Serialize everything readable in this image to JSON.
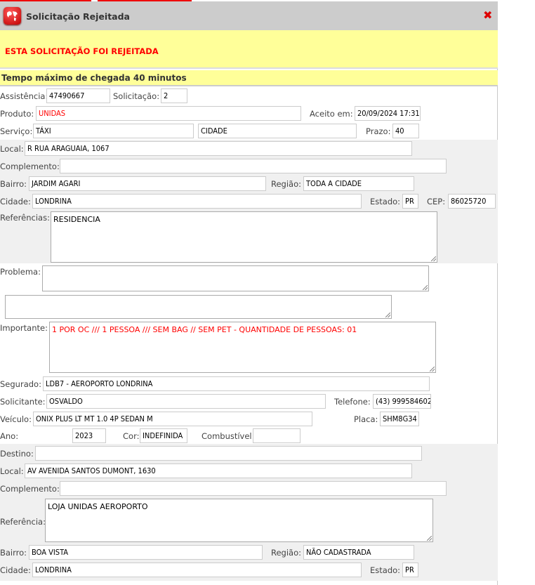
{
  "window": {
    "title": "Solicitação Rejeitada",
    "close_icon": "close-x-icon",
    "logo_icon": "world-map-icon"
  },
  "alert": {
    "message": "ESTA SOLICITAÇÃO FOI REJEITADA",
    "color": "#ff0000",
    "background": "#ffff99"
  },
  "eta": "Tempo máximo de chegada 40 minutos",
  "service": {
    "assistencia_label": "Assistência:",
    "assistencia": "47490667",
    "solicitacao_label": "Solicitação:",
    "solicitacao": "2",
    "produto_label": "Produto:",
    "produto": "UNIDAS",
    "aceito_label": "Aceito em:",
    "aceito": "20/09/2024 17:31",
    "servico_label": "Serviço:",
    "servico": "TÁXI",
    "servico_tipo": "CIDADE",
    "prazo_label": "Prazo:",
    "prazo": "40"
  },
  "origin": {
    "local_label": "Local:",
    "local": "R RUA ARAGUAIA, 1067",
    "complemento_label": "Complemento:",
    "complemento": "",
    "bairro_label": "Bairro:",
    "bairro": "JARDIM AGARI",
    "regiao_label": "Região:",
    "regiao": "TODA A CIDADE",
    "cidade_label": "Cidade:",
    "cidade": "LONDRINA",
    "estado_label": "Estado:",
    "estado": "PR",
    "cep_label": "CEP:",
    "cep": "86025720",
    "referencias_label": "Referências:",
    "referencias": "RESIDENCIA"
  },
  "problema_label": "Problema:",
  "problema": "",
  "problema_extra": "",
  "importante_label": "Importante:",
  "importante": "1 POR OC /// 1 PESSOA /// SEM BAG // SEM PET - QUANTIDADE DE PESSOAS: 01",
  "insured": {
    "segurado_label": "Segurado:",
    "segurado": "LDB7 - AEROPORTO LONDRINA",
    "solicitante_label": "Solicitante:",
    "solicitante": "OSVALDO",
    "telefone_label": "Telefone:",
    "telefone": "(43) 999584602",
    "veiculo_label": "Veículo:",
    "veiculo": "ONIX PLUS LT MT 1.0 4P SEDAN M",
    "placa_label": "Placa:",
    "placa": "SHM8G34",
    "ano_label": "Ano:",
    "ano": "2023",
    "cor_label": "Cor:",
    "cor": "INDEFINIDA",
    "combustivel_label": "Combustível:",
    "combustivel": ""
  },
  "destination": {
    "destino_label": "Destino:",
    "destino": "",
    "local_label": "Local:",
    "local": "AV AVENIDA SANTOS DUMONT, 1630",
    "complemento_label": "Complemento:",
    "complemento": "",
    "referencia_label": "Referência:",
    "referencia": "LOJA UNIDAS AEROPORTO",
    "bairro_label": "Bairro:",
    "bairro": "BOA VISTA",
    "regiao_label": "Região:",
    "regiao": "NÃO CADASTRADA",
    "cidade_label": "Cidade:",
    "cidade": "LONDRINA",
    "estado_label": "Estado:",
    "estado": "PR"
  }
}
